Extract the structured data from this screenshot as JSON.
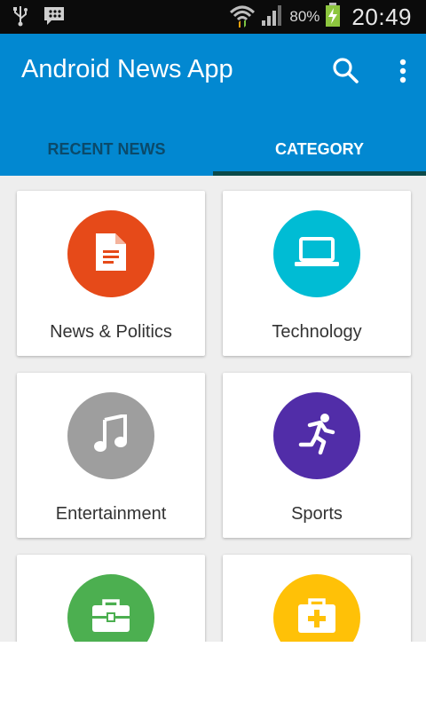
{
  "status_bar": {
    "battery_percent": "80%",
    "time": "20:49",
    "icons": [
      "usb-icon",
      "bbm-icon",
      "wifi-icon",
      "signal-icon",
      "battery-charging-icon"
    ]
  },
  "app_bar": {
    "title": "Android News App",
    "color": "#0288d1",
    "actions": [
      "search-icon",
      "more-vert-icon"
    ]
  },
  "tabs": [
    {
      "label": "RECENT NEWS",
      "selected": false
    },
    {
      "label": "CATEGORY",
      "selected": true
    }
  ],
  "categories": [
    {
      "label": "News & Politics",
      "icon": "document-icon",
      "color": "#e64a19"
    },
    {
      "label": "Technology",
      "icon": "laptop-icon",
      "color": "#00bcd4"
    },
    {
      "label": "Entertainment",
      "icon": "music-note-icon",
      "color": "#9e9e9e"
    },
    {
      "label": "Sports",
      "icon": "running-person-icon",
      "color": "#512da8"
    },
    {
      "label": "",
      "icon": "briefcase-icon",
      "color": "#4caf50"
    },
    {
      "label": "",
      "icon": "first-aid-kit-icon",
      "color": "#ffc107"
    }
  ]
}
